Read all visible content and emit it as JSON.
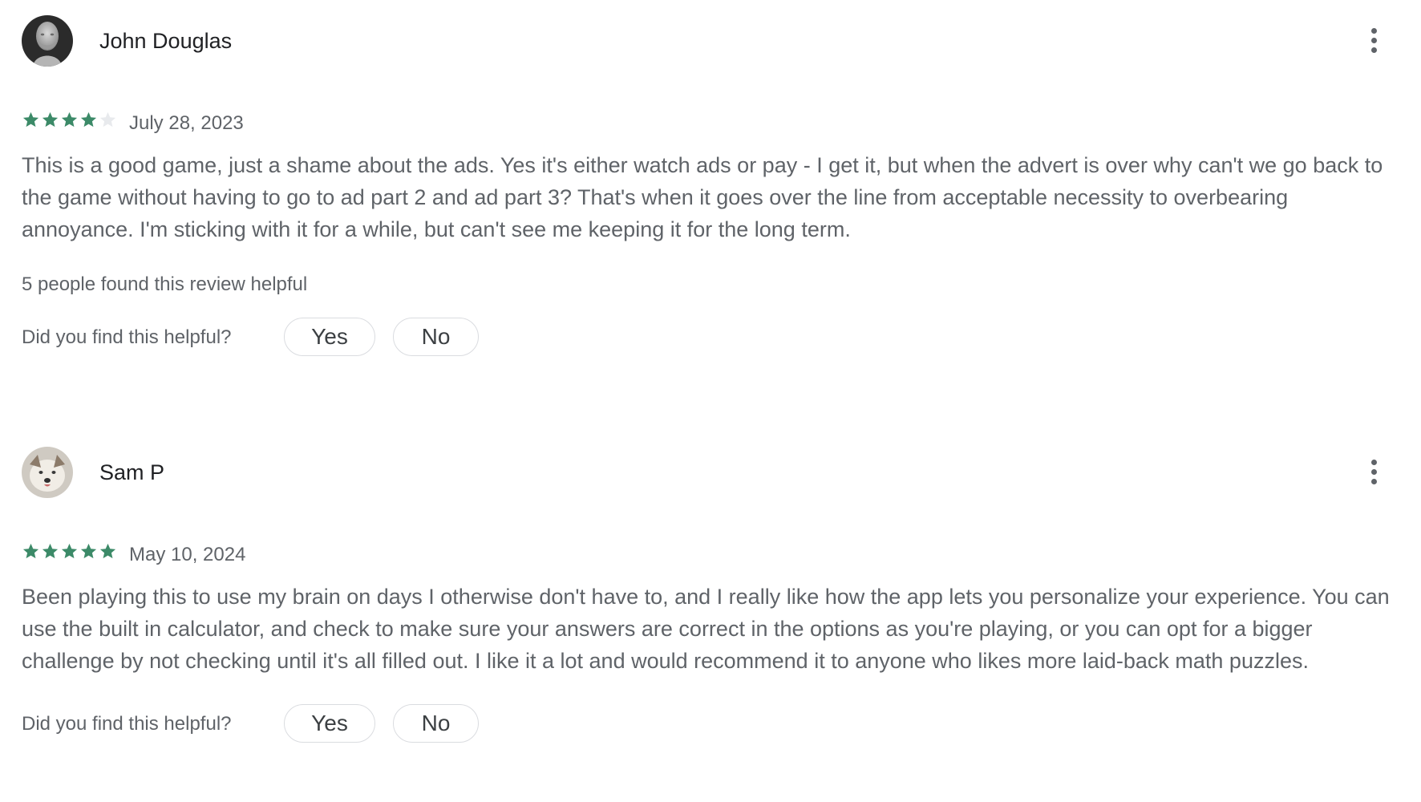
{
  "colors": {
    "star_filled": "#3c8a68",
    "star_empty": "#e8eaed",
    "text_primary": "#202124",
    "text_secondary": "#5f6368",
    "button_border": "#dadce0"
  },
  "reviews": [
    {
      "author": "John Douglas",
      "avatar_icon": "avatar-photo-bust-statue",
      "menu_icon": "more-vert-icon",
      "rating": 4,
      "rating_max": 5,
      "date": "July 28, 2023",
      "text": "This is a good game, just a shame about the ads. Yes it's either watch ads or pay - I get it, but when the advert is over why can't we go back to the game without having to go to ad part 2 and ad part 3? That's when it goes over the line from acceptable necessity to overbearing annoyance. I'm sticking with it for a while, but can't see me keeping it for the long term.",
      "helpful_count_text": "5 people found this review helpful",
      "helpful_question": "Did you find this helpful?",
      "yes_label": "Yes",
      "no_label": "No"
    },
    {
      "author": "Sam P",
      "avatar_icon": "avatar-photo-dog",
      "menu_icon": "more-vert-icon",
      "rating": 5,
      "rating_max": 5,
      "date": "May 10, 2024",
      "text": "Been playing this to use my brain on days I otherwise don't have to, and I really like how the app lets you personalize your experience. You can use the built in calculator, and check to make sure your answers are correct in the options as you're playing, or you can opt for a bigger challenge by not checking until it's all filled out. I like it a lot and would recommend it to anyone who likes more laid-back math puzzles.",
      "helpful_question": "Did you find this helpful?",
      "yes_label": "Yes",
      "no_label": "No"
    }
  ]
}
